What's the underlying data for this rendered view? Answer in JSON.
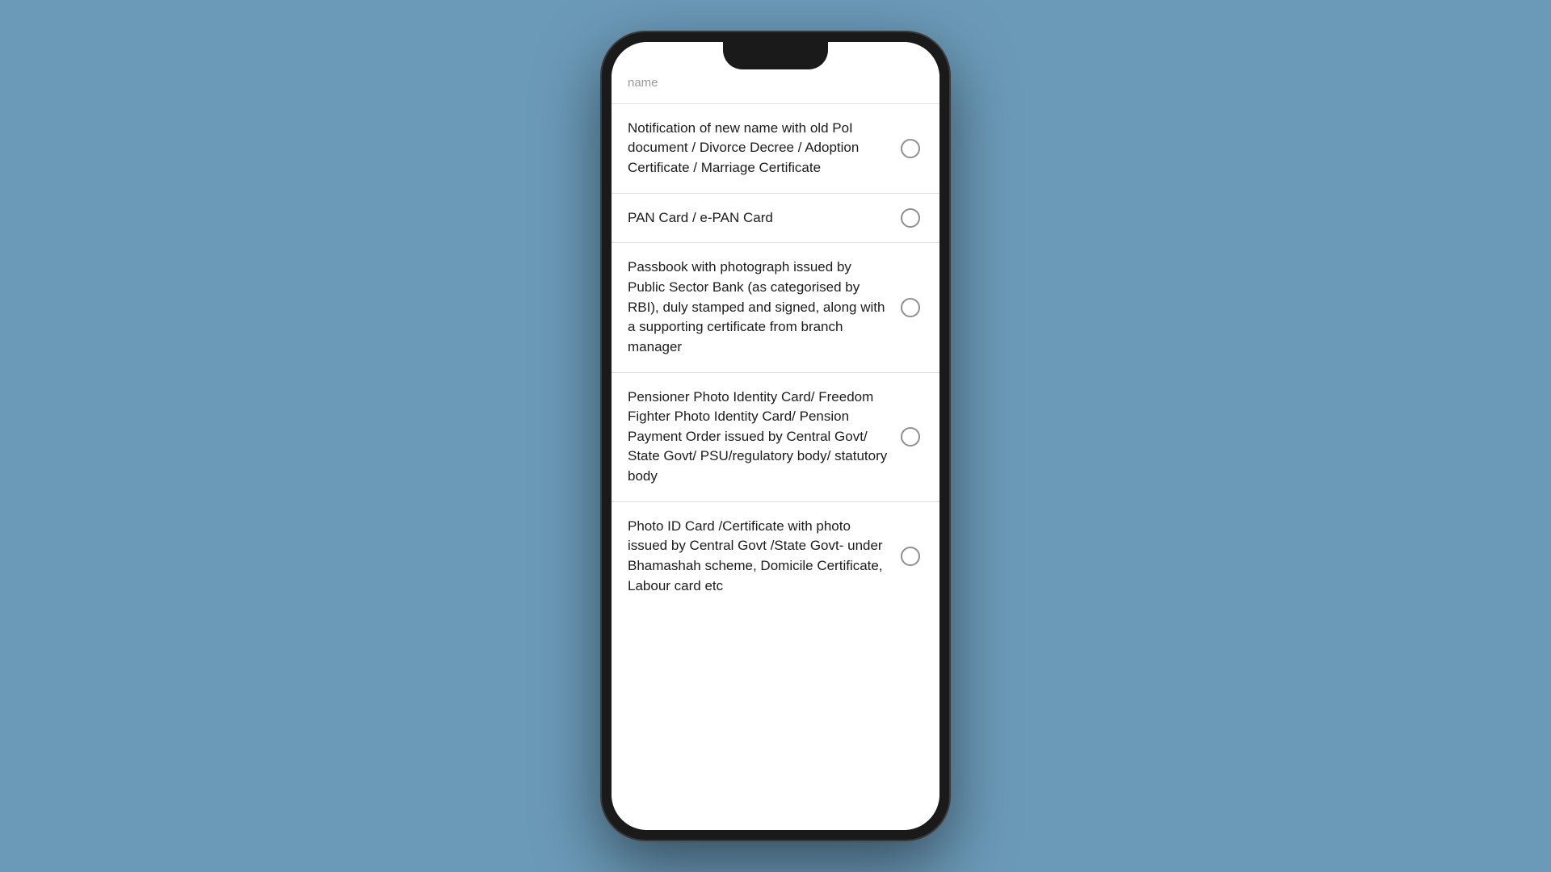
{
  "phone": {
    "background_color": "#6b9ab8"
  },
  "list": {
    "partial_label": "name",
    "items": [
      {
        "id": "item-1",
        "text": "Notification of new name with old PoI document / Divorce Decree / Adoption Certificate / Marriage Certificate",
        "selected": false
      },
      {
        "id": "item-2",
        "text": "PAN Card / e-PAN Card",
        "selected": false
      },
      {
        "id": "item-3",
        "text": "Passbook with photograph issued by Public Sector Bank (as categorised by RBI), duly stamped and signed, along with a supporting certificate from branch manager",
        "selected": false
      },
      {
        "id": "item-4",
        "text": "Pensioner Photo Identity Card/ Freedom Fighter Photo Identity Card/ Pension Payment Order issued by Central Govt/ State Govt/ PSU/regulatory body/ statutory body",
        "selected": false
      },
      {
        "id": "item-5",
        "text": "Photo ID Card /Certificate with photo issued by Central Govt /State Govt- under Bhamashah scheme, Domicile Certificate, Labour card etc",
        "selected": false
      }
    ]
  }
}
